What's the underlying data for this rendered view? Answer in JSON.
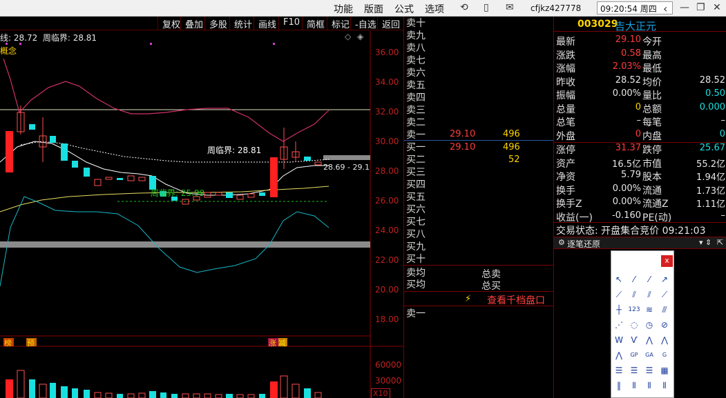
{
  "menu": [
    "功能",
    "版面",
    "公式",
    "选项"
  ],
  "user": "cfjkz427778",
  "clock": "09:20:54 周四",
  "chart_toolbar": [
    "复权",
    "叠加",
    "多股",
    "统计",
    "画线",
    "F10",
    "简框",
    "标记",
    "-自选",
    "返回"
  ],
  "legend": {
    "ma": "线: 28.72",
    "weekly": "周临界: 28.81"
  },
  "concept_label": "概念",
  "weekly_line_label": "周临界: 28.81",
  "weekly_low_label": "周临界: 25.99",
  "range_label": "28.69 - 29.1",
  "y_ticks": [
    "36.00",
    "34.00",
    "32.00",
    "30.00",
    "28.00",
    "26.00",
    "24.00",
    "22.00",
    "20.00",
    "18.00"
  ],
  "vol_ticks": [
    "60000",
    "30000"
  ],
  "vol_unit": "X10",
  "signals": [
    "榜",
    "预",
    "涨"
  ],
  "signal_mid": "减",
  "orderbook": {
    "sell": [
      "卖十",
      "卖九",
      "卖八",
      "卖七",
      "卖六",
      "卖五",
      "卖四",
      "卖三",
      "卖二",
      "卖一"
    ],
    "buy": [
      "买一",
      "买二",
      "买三",
      "买四",
      "买五",
      "买六",
      "买七",
      "买八",
      "买九",
      "买十"
    ],
    "sell1_price": "29.10",
    "sell1_vol": "496",
    "buy1_price": "29.10",
    "buy1_vol": "496",
    "buy2_vol": "52",
    "avg_sell": "卖均",
    "avg_buy": "买均",
    "total_sell": "总卖",
    "total_buy": "总买",
    "view_link": "查看千档盘口",
    "tick_label": "卖一"
  },
  "stock": {
    "code": "003029",
    "name": "吉大正元"
  },
  "quote_rows": [
    {
      "l": "最新",
      "v": "29.10",
      "vc": "red",
      "r": "今开",
      "rv": "",
      "rc": "white"
    },
    {
      "l": "涨跌",
      "v": "0.58",
      "vc": "red",
      "r": "最高",
      "rv": "",
      "rc": "white"
    },
    {
      "l": "涨幅",
      "v": "2.03%",
      "vc": "red",
      "r": "最低",
      "rv": "",
      "rc": "white"
    },
    {
      "l": "昨收",
      "v": "28.52",
      "vc": "white",
      "r": "均价",
      "rv": "28.52",
      "rc": "white"
    },
    {
      "l": "振幅",
      "v": "0.00%",
      "vc": "white",
      "r": "量比",
      "rv": "0.50",
      "rc": "green"
    },
    {
      "l": "总量",
      "v": "0",
      "vc": "yellow",
      "r": "总额",
      "rv": "0.000",
      "rc": "green"
    },
    {
      "l": "总笔",
      "v": "–",
      "vc": "white",
      "r": "每笔",
      "rv": "–",
      "rc": "white"
    },
    {
      "l": "外盘",
      "v": "0",
      "vc": "red",
      "r": "内盘",
      "rv": "0",
      "rc": "green"
    }
  ],
  "quote_rows2": [
    {
      "l": "涨停",
      "v": "31.37",
      "vc": "red",
      "r": "跌停",
      "rv": "25.67",
      "rc": "green"
    },
    {
      "l": "资产",
      "v": "16.5亿",
      "vc": "white",
      "r": "市值",
      "rv": "55.2亿",
      "rc": "white"
    },
    {
      "l": "净资",
      "v": "5.79",
      "vc": "white",
      "r": "股本",
      "rv": "1.94亿",
      "rc": "white"
    },
    {
      "l": "换手",
      "v": "0.00%",
      "vc": "white",
      "r": "流通",
      "rv": "1.73亿",
      "rc": "white"
    },
    {
      "l": "换手Z",
      "v": "0.00%",
      "vc": "white",
      "r": "流通Z",
      "rv": "1.11亿",
      "rc": "white"
    },
    {
      "l": "收益(一)",
      "v": "-0.160",
      "vc": "white",
      "r": "PE(动)",
      "rv": "–",
      "rc": "white"
    }
  ],
  "trade_status": "交易状态: 开盘集合竞价 09:21:03",
  "tick_panel_title": "逐笔还原",
  "close_glyph": "x"
}
